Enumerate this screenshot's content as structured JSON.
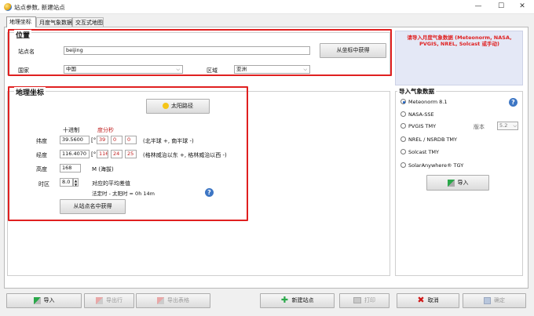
{
  "window": {
    "title": "站点参数, 新建站点",
    "min": "—",
    "max": "☐",
    "close": "✕"
  },
  "tabs": [
    {
      "label": "地理坐标"
    },
    {
      "label": "月度气象数据"
    },
    {
      "label": "交互式地图"
    }
  ],
  "position": {
    "title": "位置",
    "site_name_label": "站点名",
    "site_name_value": "beijing",
    "from_coords_button": "从坐标中获得",
    "country_label": "国家",
    "country_value": "中国",
    "region_label": "区域",
    "region_value": "亚洲"
  },
  "hint": {
    "text": "请导入月度气象数据 (Meteonorm, NASA, PVGIS, NREL, Solcast 或手动)",
    "color": "#e02020"
  },
  "geo": {
    "title": "地理坐标",
    "sun_path_button": "太阳路径",
    "decimal_header": "十进制",
    "dms_header": "度分秒",
    "latitude_label": "纬度",
    "latitude_decimal": "39.5600",
    "latitude_unit": "[°]",
    "latitude_deg": "39",
    "latitude_min": "0",
    "latitude_sec": "0",
    "latitude_note": "(北半球 +, 南半球 -)",
    "longitude_label": "经度",
    "longitude_decimal": "116.4070",
    "longitude_unit": "[°]",
    "longitude_deg": "116",
    "longitude_min": "24",
    "longitude_sec": "25",
    "longitude_note": "(格林威治以东 +, 格林威治以西 -)",
    "altitude_label": "高度",
    "altitude_value": "168",
    "altitude_unit": "M (海拔)",
    "timezone_label": "时区",
    "timezone_value": "8.0",
    "avg_diff_label": "对应的平均差值",
    "legal_time_diff": "法定时 - 太阳时 =   0h 14m",
    "from_site_name_button": "从站点名中获得"
  },
  "import": {
    "title": "导入气象数据",
    "options": [
      {
        "label": "Meteonorm 8.1",
        "selected": true
      },
      {
        "label": "NASA-SSE",
        "selected": false
      },
      {
        "label": "PVGIS TMY",
        "selected": false
      },
      {
        "label": "NREL / NSRDB TMY",
        "selected": false
      },
      {
        "label": "Solcast TMY",
        "selected": false
      },
      {
        "label": "SolarAnywhere® TGY",
        "selected": false
      }
    ],
    "version_label": "版本",
    "version_value": "5.2",
    "import_button": "导入"
  },
  "bottom": {
    "import": "导入",
    "export_row": "导出行",
    "export_table": "导出表格",
    "new_site": "新建站点",
    "print": "打印",
    "cancel": "取消",
    "ok": "确定"
  },
  "colors": {
    "highlight_red": "#e02020",
    "accent_blue": "#1a5fbf",
    "dms_red": "#c02020"
  }
}
